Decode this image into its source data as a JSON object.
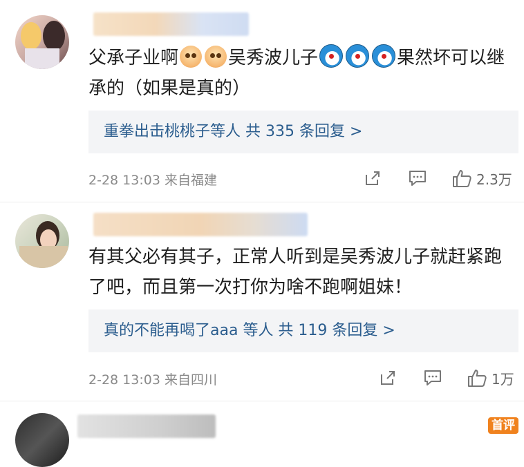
{
  "comments": [
    {
      "text_parts": [
        "父承子业啊",
        "吴秀波儿子",
        "果然坏可以继承的（如果是真的）"
      ],
      "emojis": [
        "smiling-face-emoji",
        "smiling-face-emoji",
        "doraemon-emoji",
        "doraemon-emoji",
        "doraemon-emoji"
      ],
      "reply_summary": "重拳出击桃桃子等人 共 335 条回复 >",
      "meta": "2-28 13:03  来自福建",
      "likes": "2.3万"
    },
    {
      "text": "有其父必有其子，正常人听到是吴秀波儿子就赶紧跑了吧，而且第一次打你为啥不跑啊姐妹！",
      "reply_summary": "真的不能再喝了aaa 等人 共 119 条回复 >",
      "meta": "2-28 13:03  来自四川",
      "likes": "1万"
    }
  ],
  "badge": "首评",
  "colors": {
    "link": "#2b5d8e",
    "reply_bg": "#f3f4f6",
    "meta": "#8a8a8a",
    "badge": "#f0821e"
  }
}
